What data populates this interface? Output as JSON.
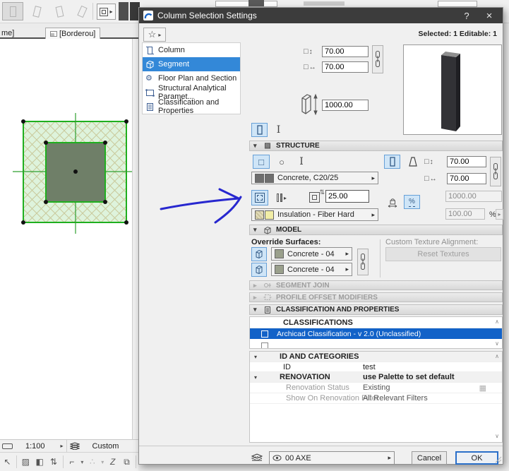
{
  "glyphs": {
    "star": "☆",
    "flyout": "▸",
    "expanded": "▾",
    "collapsed": "▸",
    "help": "?",
    "close": "×",
    "chev_up": "∧",
    "chev_down": "∨",
    "percent": "%",
    "v_arrow": "↕",
    "h_arrow": "↔",
    "square": "□",
    "circle": "○",
    "gear": "⚙",
    "grid": "▦",
    "hatch": "▨",
    "pointer": "↖",
    "hatch2": "◧",
    "updown": "⇅",
    "frame": "⌐",
    "dots": "∴",
    "zed": "Z",
    "stack": "⧉"
  },
  "background": {
    "tabs": {
      "partial": "me]",
      "active": "[Borderou]"
    },
    "statusbar": {
      "scale": "1:100",
      "layer_combo": "Custom"
    }
  },
  "dialog": {
    "title": "Column Selection Settings",
    "selected_info": "Selected: 1 Editable: 1",
    "tree": {
      "items": [
        {
          "label": "Column"
        },
        {
          "label": "Segment"
        },
        {
          "label": "Floor Plan and Section"
        },
        {
          "label": "Structural Analytical Paramet..."
        },
        {
          "label": "Classification and Properties"
        }
      ]
    },
    "geometry": {
      "width": "70.00",
      "depth": "70.00",
      "height": "1000.00"
    },
    "structure": {
      "title": "STRUCTURE",
      "material": "Concrete, C20/25",
      "veneer_thickness": "25.00",
      "insulation": "Insulation - Fiber Hard",
      "core_width": "70.00",
      "core_depth": "70.00",
      "core_height": "1000.00",
      "core_percent": "100.00",
      "percent_sign": "%"
    },
    "model": {
      "title": "MODEL",
      "override_surfaces_label": "Override Surfaces:",
      "surface_top": "Concrete - 04",
      "surface_bottom": "Concrete - 04",
      "custom_texture_label": "Custom Texture Alignment:",
      "reset_textures_label": "Reset Textures"
    },
    "segment_join": {
      "title": "SEGMENT JOIN"
    },
    "profile_offset": {
      "title": "PROFILE OFFSET MODIFIERS"
    },
    "classification": {
      "title": "CLASSIFICATION AND PROPERTIES",
      "list_header": "CLASSIFICATIONS",
      "selected_item": "Archicad Classification - v 2.0 (Unclassified)"
    },
    "properties": {
      "id_section": "ID AND CATEGORIES",
      "id_label": "ID",
      "id_value": "test",
      "renovation_section": "RENOVATION",
      "renovation_default": "use Palette to set default",
      "status_label": "Renovation Status",
      "status_value": "Existing",
      "filter_label": "Show On Renovation Filter",
      "filter_value": "All Relevant Filters"
    },
    "footer": {
      "layer": "00 AXE",
      "cancel": "Cancel",
      "ok": "OK"
    }
  }
}
